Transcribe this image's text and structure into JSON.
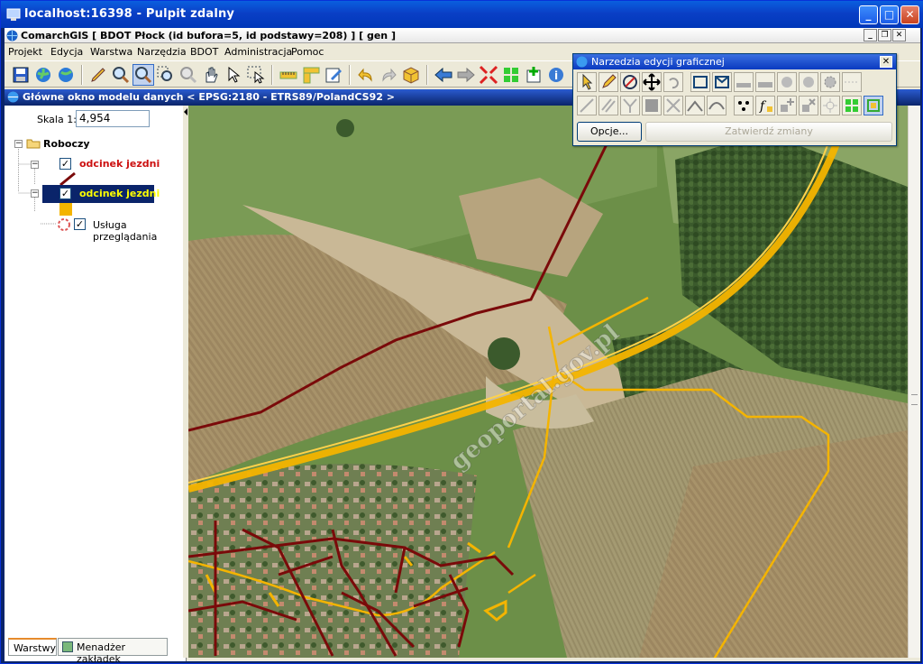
{
  "window": {
    "title": "localhost:16398 - Pulpit zdalny"
  },
  "app": {
    "title": "ComarchGIS  [ BDOT Płock (id bufora=5, id podstawy=208) ] [ gen ]"
  },
  "menu": {
    "items": [
      "Projekt",
      "Edycja",
      "Warstwa",
      "Narzędzia",
      "BDOT",
      "Administracja",
      "Pomoc"
    ]
  },
  "map_window": {
    "title": "Główne okno modelu danych < EPSG:2180 - ETRS89/PolandCS92 >"
  },
  "panel": {
    "scale_label": "Skala 1:",
    "scale_value": "4,954",
    "tree": {
      "root": "Roboczy",
      "layer1": "odcinek jezdni",
      "layer2": "odcinek jezdni",
      "layer3": "Usługa przeglądania"
    },
    "tabs": [
      "Warstwy",
      "Menadżer zakładek"
    ]
  },
  "toolbox": {
    "title": "Narzedzia edycji graficznej",
    "options_label": "Opcje...",
    "confirm_label": "Zatwierdź zmiany"
  },
  "map": {
    "watermark": "geoportal.gov.pl",
    "colors": {
      "layer1": "#7a0a0a",
      "layer2": "#f4b400",
      "selection": "#0a246a"
    }
  },
  "toolbar_icons": [
    "save-icon",
    "globe-icon",
    "globe-icon",
    "pencil-icon",
    "zoom-in-icon",
    "zoom-icon",
    "zoom-window-icon",
    "zoom-out-icon",
    "pan-hand-icon",
    "select-arrow-icon",
    "select-window-icon",
    "ruler-icon",
    "measure-icon",
    "edit-icon",
    "undo-icon",
    "redo-icon",
    "box-icon",
    "arrow-left-icon",
    "arrow-right-icon",
    "collapse-icon",
    "refresh-icon",
    "add-layer-icon",
    "info-icon"
  ]
}
